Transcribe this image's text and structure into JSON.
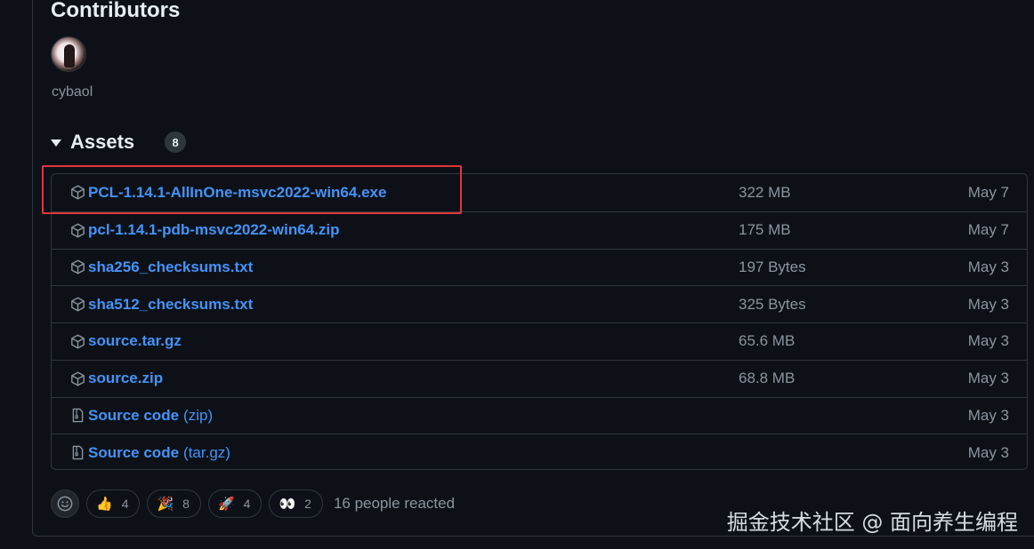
{
  "contributors": {
    "title": "Contributors",
    "users": [
      {
        "name": "cybaol"
      }
    ]
  },
  "assets": {
    "title": "Assets",
    "count": "8",
    "rows": [
      {
        "name": "PCL-1.14.1-AllInOne-msvc2022-win64.exe",
        "suffix": "",
        "size": "322 MB",
        "date": "May 7",
        "icon": "package-icon"
      },
      {
        "name": "pcl-1.14.1-pdb-msvc2022-win64.zip",
        "suffix": "",
        "size": "175 MB",
        "date": "May 7",
        "icon": "package-icon"
      },
      {
        "name": "sha256_checksums.txt",
        "suffix": "",
        "size": "197 Bytes",
        "date": "May 3",
        "icon": "package-icon"
      },
      {
        "name": "sha512_checksums.txt",
        "suffix": "",
        "size": "325 Bytes",
        "date": "May 3",
        "icon": "package-icon"
      },
      {
        "name": "source.tar.gz",
        "suffix": "",
        "size": "65.6 MB",
        "date": "May 3",
        "icon": "package-icon"
      },
      {
        "name": "source.zip",
        "suffix": "",
        "size": "68.8 MB",
        "date": "May 3",
        "icon": "package-icon"
      },
      {
        "name": "Source code",
        "suffix": "(zip)",
        "size": "",
        "date": "May 3",
        "icon": "file-zip-icon"
      },
      {
        "name": "Source code",
        "suffix": "(tar.gz)",
        "size": "",
        "date": "May 3",
        "icon": "file-zip-icon"
      }
    ]
  },
  "reactions": {
    "items": [
      {
        "emoji": "👍",
        "count": "4",
        "icon": "thumbs-up-icon"
      },
      {
        "emoji": "🎉",
        "count": "8",
        "icon": "party-icon"
      },
      {
        "emoji": "🚀",
        "count": "4",
        "icon": "rocket-icon"
      },
      {
        "emoji": "👀",
        "count": "2",
        "icon": "eyes-icon"
      }
    ],
    "summary": "16 people reacted"
  },
  "watermark": "掘金技术社区 @ 面向养生编程",
  "colors": {
    "link": "#4493f8",
    "muted": "#8b949e",
    "highlight": "#e0363d",
    "background": "#0d1117"
  }
}
